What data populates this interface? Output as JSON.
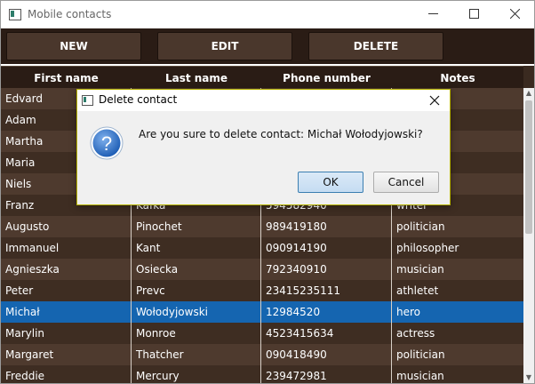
{
  "window": {
    "title": "Mobile contacts",
    "controls": [
      "minimize-icon",
      "maximize-icon",
      "close-icon"
    ]
  },
  "toolbar": {
    "new_label": "NEW",
    "edit_label": "EDIT",
    "delete_label": "DELETE"
  },
  "table": {
    "columns": [
      "First name",
      "Last name",
      "Phone number",
      "Notes"
    ],
    "rows": [
      [
        "Edvard",
        "",
        "",
        ""
      ],
      [
        "Adam",
        "",
        "",
        ""
      ],
      [
        "Martha",
        "",
        "",
        ""
      ],
      [
        "Maria",
        "",
        "",
        ""
      ],
      [
        "Niels",
        "",
        "",
        ""
      ],
      [
        "Franz",
        "Kafka",
        "594582940",
        "writer"
      ],
      [
        "Augusto",
        "Pinochet",
        "989419180",
        "politician"
      ],
      [
        "Immanuel",
        "Kant",
        "090914190",
        "philosopher"
      ],
      [
        "Agnieszka",
        "Osiecka",
        "792340910",
        "musician"
      ],
      [
        "Peter",
        "Prevc",
        "23415235111",
        "athletet"
      ],
      [
        "Michał",
        "Wołodyjowski",
        "12984520",
        "hero"
      ],
      [
        "Marylin",
        "Monroe",
        "4523415634",
        "actress"
      ],
      [
        "Margaret",
        "Thatcher",
        "090418490",
        "politician"
      ],
      [
        "Freddie",
        "Mercury",
        "239472981",
        "musician"
      ]
    ],
    "selected_row": 10
  },
  "dialog": {
    "title": "Delete contact",
    "message": "Are you sure to delete contact: Michał Wołodyjowski?",
    "icon": "question-icon",
    "ok_label": "OK",
    "cancel_label": "Cancel"
  },
  "colors": {
    "toolbar_bg": "#2a1c15",
    "button_bg": "#4a372c",
    "row_odd": "#4e3a2e",
    "row_even": "#3e2d22",
    "selection": "#1565b0",
    "dialog_border": "#b5b200"
  }
}
